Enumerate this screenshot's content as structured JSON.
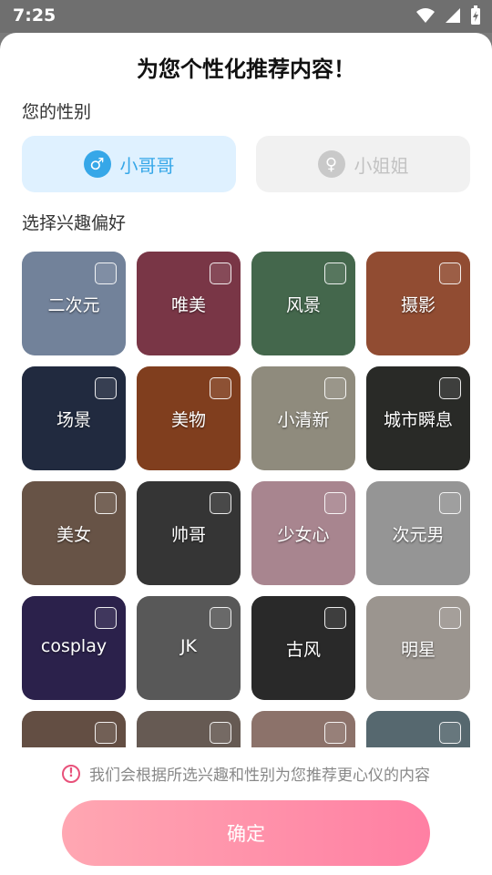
{
  "status_bar": {
    "time": "7:25"
  },
  "title": "为您个性化推荐内容！",
  "gender_label": "您的性别",
  "gender_options": [
    {
      "label": "小哥哥",
      "symbol": "♂",
      "selected": true
    },
    {
      "label": "小姐姐",
      "symbol": "♀",
      "selected": false
    }
  ],
  "interest_label": "选择兴趣偏好",
  "interests": [
    {
      "label": "二次元",
      "color": "#9fb5d6"
    },
    {
      "label": "唯美",
      "color": "#a84c62"
    },
    {
      "label": "风景",
      "color": "#5f8f6a"
    },
    {
      "label": "摄影",
      "color": "#c96a46"
    },
    {
      "label": "场景",
      "color": "#2e3b58"
    },
    {
      "label": "美物",
      "color": "#b2562a"
    },
    {
      "label": "小清新",
      "color": "#c7c1ad"
    },
    {
      "label": "城市瞬息",
      "color": "#3a3b36"
    },
    {
      "label": "美女",
      "color": "#8f7461"
    },
    {
      "label": "帅哥",
      "color": "#4a4a4a"
    },
    {
      "label": "少女心",
      "color": "#e9b9c6"
    },
    {
      "label": "次元男",
      "color": "#cfcfcf"
    },
    {
      "label": "cosplay",
      "color": "#3c2e68"
    },
    {
      "label": "JK",
      "color": "#7b7b7b"
    },
    {
      "label": "古风",
      "color": "#3a3a3a"
    },
    {
      "label": "明星",
      "color": "#d7cfc7"
    },
    {
      "label": "",
      "color": "#8a6d5d"
    },
    {
      "label": "",
      "color": "#8e7d74"
    },
    {
      "label": "",
      "color": "#c39f93"
    },
    {
      "label": "",
      "color": "#78909a"
    }
  ],
  "notice": "我们会根据所选兴趣和性别为您推荐更心仪的内容",
  "confirm_label": "确定"
}
